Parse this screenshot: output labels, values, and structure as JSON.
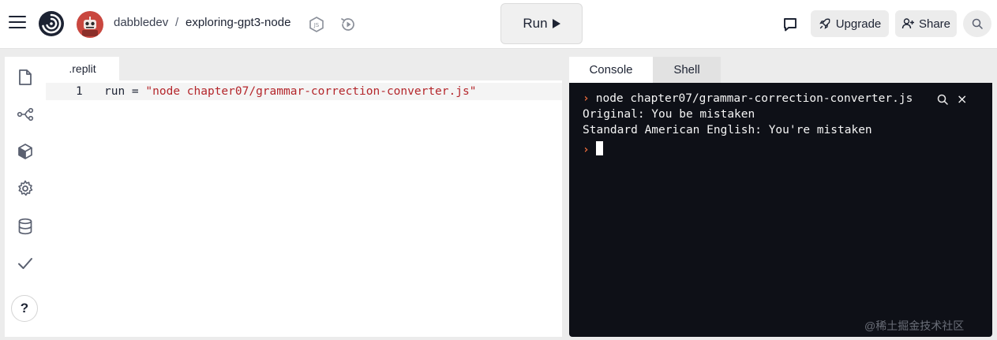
{
  "header": {
    "user": "dabbledev",
    "separator": "/",
    "repl_name": "exploring-gpt3-node",
    "run_label": "Run",
    "upgrade_label": "Upgrade",
    "share_label": "Share"
  },
  "sidebar": {
    "items": [
      "files-icon",
      "version-control-icon",
      "packages-icon",
      "settings-icon",
      "database-icon",
      "checkmark-icon"
    ],
    "help_label": "?"
  },
  "editor": {
    "tab_label": ".replit",
    "line_number": "1",
    "code_key": "run",
    "code_op": " = ",
    "code_value": "\"node chapter07/grammar-correction-converter.js\""
  },
  "console": {
    "tabs": [
      "Console",
      "Shell"
    ],
    "prompt_symbol": "›",
    "lines": [
      "node chapter07/grammar-correction-converter.js",
      "Original: You be mistaken",
      "Standard American English: You're mistaken"
    ],
    "close_symbol": "×"
  },
  "colors": {
    "terminal_bg": "#0e1017",
    "prompt": "#e76a3c",
    "string": "#b4262b"
  },
  "watermark": "@稀土掘金技术社区"
}
